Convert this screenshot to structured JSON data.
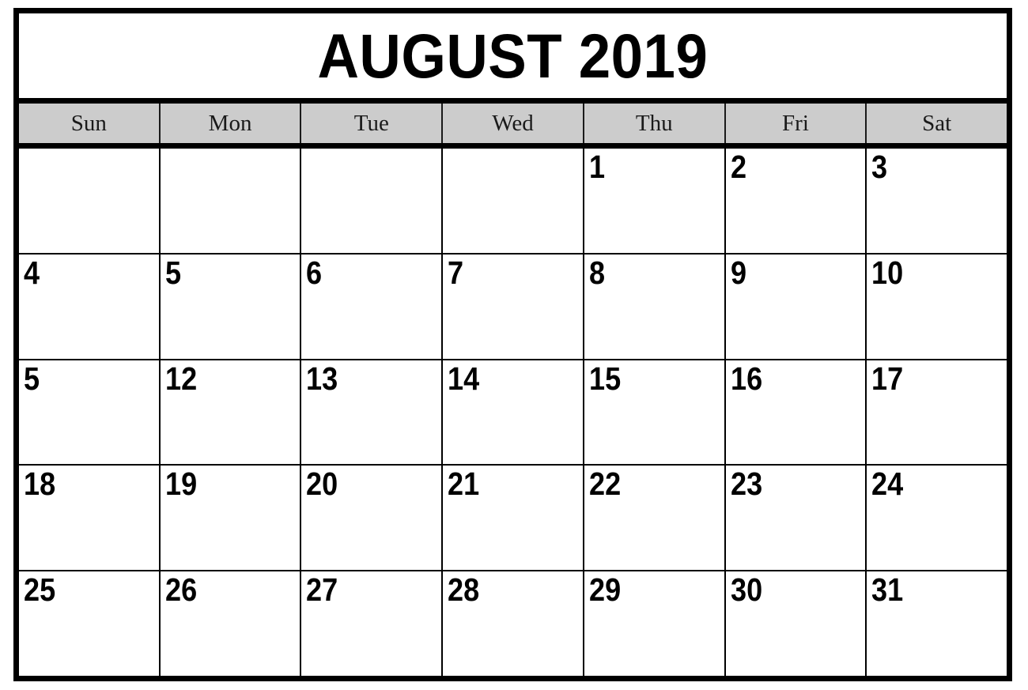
{
  "calendar": {
    "title": "AUGUST 2019",
    "month": "AUGUST",
    "year": "2019",
    "colors": {
      "frame": "#000000",
      "header_background": "#cccccc",
      "cell_background": "#ffffff",
      "text": "#000000",
      "grid_line": "#000000"
    },
    "weekdays": [
      {
        "label": "Sun"
      },
      {
        "label": "Mon"
      },
      {
        "label": "Tue"
      },
      {
        "label": "Wed"
      },
      {
        "label": "Thu"
      },
      {
        "label": "Fri"
      },
      {
        "label": "Sat"
      }
    ],
    "weeks": [
      {
        "days": [
          {
            "label": ""
          },
          {
            "label": ""
          },
          {
            "label": ""
          },
          {
            "label": ""
          },
          {
            "label": "1"
          },
          {
            "label": "2"
          },
          {
            "label": "3"
          }
        ]
      },
      {
        "days": [
          {
            "label": "4"
          },
          {
            "label": "5"
          },
          {
            "label": "6"
          },
          {
            "label": "7"
          },
          {
            "label": "8"
          },
          {
            "label": "9"
          },
          {
            "label": "10"
          }
        ]
      },
      {
        "days": [
          {
            "label": "5"
          },
          {
            "label": "12"
          },
          {
            "label": "13"
          },
          {
            "label": "14"
          },
          {
            "label": "15"
          },
          {
            "label": "16"
          },
          {
            "label": "17"
          }
        ]
      },
      {
        "days": [
          {
            "label": "18"
          },
          {
            "label": "19"
          },
          {
            "label": "20"
          },
          {
            "label": "21"
          },
          {
            "label": "22"
          },
          {
            "label": "23"
          },
          {
            "label": "24"
          }
        ]
      },
      {
        "days": [
          {
            "label": "25"
          },
          {
            "label": "26"
          },
          {
            "label": "27"
          },
          {
            "label": "28"
          },
          {
            "label": "29"
          },
          {
            "label": "30"
          },
          {
            "label": "31"
          }
        ]
      }
    ]
  }
}
